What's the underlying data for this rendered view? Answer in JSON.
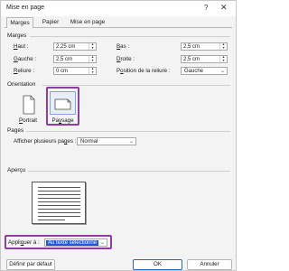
{
  "window": {
    "title": "Mise en page",
    "help_glyph": "?",
    "close_glyph": "✕"
  },
  "tabs": [
    {
      "label": "Marges",
      "active": true
    },
    {
      "label": "Papier",
      "active": false
    },
    {
      "label": "Mise en page",
      "active": false
    }
  ],
  "margins": {
    "section_label": "Marges",
    "haut": {
      "label_pre": "",
      "label_key": "H",
      "label_post": "aut :",
      "value": "2,25 cm"
    },
    "bas": {
      "label_pre": "",
      "label_key": "B",
      "label_post": "as :",
      "value": "2,5 cm"
    },
    "gauche": {
      "label_pre": "",
      "label_key": "G",
      "label_post": "auche :",
      "value": "2,5 cm"
    },
    "droite": {
      "label_pre": "",
      "label_key": "D",
      "label_post": "roite :",
      "value": "2,5 cm"
    },
    "reliure": {
      "label_pre": "",
      "label_key": "R",
      "label_post": "eliure :",
      "value": "0 cm"
    },
    "position_reliure": {
      "label_pre": "P",
      "label_key": "o",
      "label_post": "sition de la reliure :",
      "value": "Gauche"
    }
  },
  "orientation": {
    "section_label": "Orientation",
    "portrait": {
      "label_key": "P",
      "label_rest": "ortrait",
      "selected": false
    },
    "paysage": {
      "label_pre": "Pa",
      "label_key": "y",
      "label_post": "sage",
      "selected": true
    }
  },
  "pages": {
    "section_label": "Pages",
    "plusieurs_label_pre": "Afficher plusieurs pa",
    "plusieurs_label_key": "g",
    "plusieurs_label_post": "es :",
    "plusieurs_value": "Normal"
  },
  "apercu": {
    "section_label": "Aperçu"
  },
  "appliquer": {
    "label_pre": "Appli",
    "label_key": "q",
    "label_post": "uer à :",
    "value": "Au texte sélectionné"
  },
  "buttons": {
    "default": "Définir par défaut",
    "ok": "OK",
    "cancel": "Annuler"
  },
  "colors": {
    "highlight": "#8e3ea0",
    "selection": "#1e5bd6",
    "primary_border": "#2a62c9",
    "dialog_bg": "#f3f3f3"
  },
  "icons": {
    "portrait": "portrait-page-icon",
    "paysage": "landscape-page-icon",
    "spin": "spin-arrows-icon",
    "dropdown": "chevron-down-icon"
  }
}
